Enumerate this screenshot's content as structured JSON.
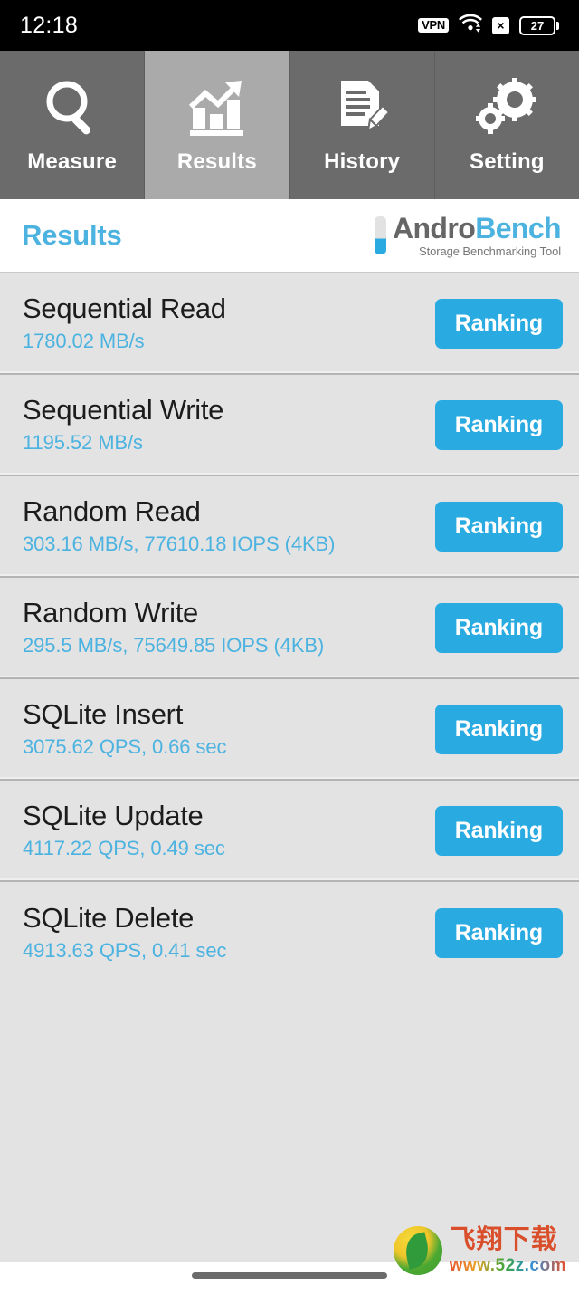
{
  "status_bar": {
    "clock": "12:18",
    "vpn_label": "VPN",
    "wifi_icon": "wifi-icon",
    "signal_off_label": "×",
    "battery_level": "27"
  },
  "tabs": [
    {
      "label": "Measure",
      "icon": "magnifier-icon",
      "active": false
    },
    {
      "label": "Results",
      "icon": "bar-chart-icon",
      "active": true
    },
    {
      "label": "History",
      "icon": "document-pencil-icon",
      "active": false
    },
    {
      "label": "Setting",
      "icon": "gears-icon",
      "active": false
    }
  ],
  "header": {
    "page_title": "Results",
    "logo_part1": "Andro",
    "logo_part2": "Bench",
    "logo_tagline": "Storage Benchmarking Tool"
  },
  "results": [
    {
      "name": "Sequential Read",
      "value": "1780.02 MB/s",
      "button": "Ranking"
    },
    {
      "name": "Sequential Write",
      "value": "1195.52 MB/s",
      "button": "Ranking"
    },
    {
      "name": "Random Read",
      "value": "303.16 MB/s, 77610.18 IOPS (4KB)",
      "button": "Ranking"
    },
    {
      "name": "Random Write",
      "value": "295.5 MB/s, 75649.85 IOPS (4KB)",
      "button": "Ranking"
    },
    {
      "name": "SQLite Insert",
      "value": "3075.62 QPS, 0.66 sec",
      "button": "Ranking"
    },
    {
      "name": "SQLite Update",
      "value": "4117.22 QPS, 0.49 sec",
      "button": "Ranking"
    },
    {
      "name": "SQLite Delete",
      "value": "4913.63 QPS, 0.41 sec",
      "button": "Ranking"
    }
  ],
  "watermark": {
    "brand_cn": "飞翔下载",
    "url": "www.52z.com"
  },
  "colors": {
    "accent_blue": "#29abe2",
    "title_blue": "#4cb3e0",
    "list_background": "#e3e3e3",
    "tab_inactive": "#6b6b6b",
    "tab_active": "#aaaaaa",
    "status_bar": "#000000"
  }
}
